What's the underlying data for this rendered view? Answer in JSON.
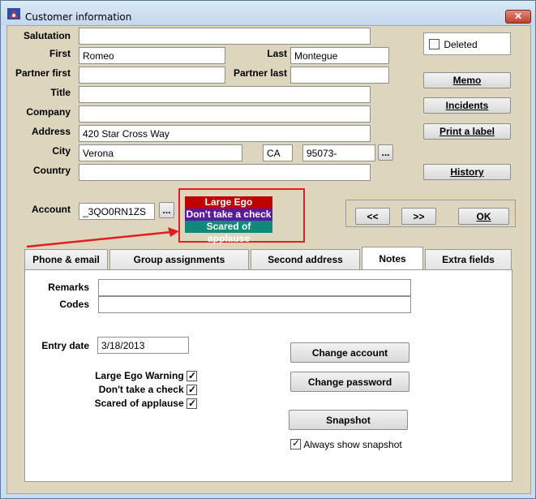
{
  "window": {
    "title": "Customer information",
    "close_label": "✕"
  },
  "labels": {
    "salutation": "Salutation",
    "first": "First",
    "last": "Last",
    "partner_first": "Partner first",
    "partner_last": "Partner last",
    "title": "Title",
    "company": "Company",
    "address": "Address",
    "city": "City",
    "country": "Country",
    "account": "Account"
  },
  "fields": {
    "salutation": "",
    "first": "Romeo",
    "last": "Montegue",
    "partner_first": "",
    "partner_last": "",
    "title": "",
    "company": "",
    "address": "420 Star Cross Way",
    "city": "Verona",
    "state": "CA",
    "zip": "95073-",
    "country": "",
    "account": "_3QO0RN1ZS"
  },
  "ellipsis": "...",
  "deleted": {
    "label": "Deleted",
    "checked": false
  },
  "side_buttons": {
    "memo": "Memo",
    "incidents": "Incidents",
    "print_label": "Print a label",
    "history": "History"
  },
  "nav": {
    "prev": "<<",
    "next": ">>",
    "ok": "OK"
  },
  "flags": [
    {
      "label": "Large Ego Warning",
      "color": "#c00000"
    },
    {
      "label": "Don't take a check",
      "color": "#5a1aa0"
    },
    {
      "label": "Scared of applause",
      "color": "#0f8a7a"
    }
  ],
  "highlight_color": "#e02020",
  "tabs": [
    {
      "label": "Phone & email",
      "active": false
    },
    {
      "label": "Group assignments",
      "active": false
    },
    {
      "label": "Second address",
      "active": false
    },
    {
      "label": "Notes",
      "active": true
    },
    {
      "label": "Extra fields",
      "active": false
    }
  ],
  "notes": {
    "remarks_label": "Remarks",
    "remarks_value": "",
    "codes_label": "Codes",
    "codes_value": "",
    "entry_date_label": "Entry date",
    "entry_date_value": "3/18/2013",
    "checks": [
      {
        "label": "Large Ego Warning",
        "checked": true
      },
      {
        "label": "Don't take a check",
        "checked": true
      },
      {
        "label": "Scared of applause",
        "checked": true
      }
    ],
    "change_account": "Change account",
    "change_password": "Change password",
    "snapshot": "Snapshot",
    "always_show_snapshot": {
      "label": "Always show snapshot",
      "checked": true
    }
  }
}
